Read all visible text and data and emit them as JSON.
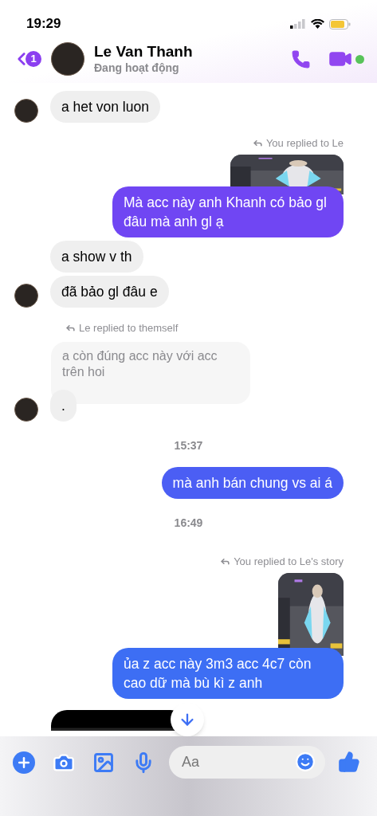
{
  "status_bar": {
    "time": "19:29"
  },
  "header": {
    "back_badge": "1",
    "name": "Le Van Thanh",
    "status": "Đang hoạt động",
    "online": true
  },
  "messages": [
    {
      "kind": "received",
      "text": "a het von luon",
      "avatar": true
    },
    {
      "kind": "reply_label_sent",
      "text": "You replied to Le"
    },
    {
      "kind": "reply_image"
    },
    {
      "kind": "sent",
      "text": "Mà acc này anh Khanh có bảo gl đâu mà anh gl ạ",
      "color": "#7046f3"
    },
    {
      "kind": "received",
      "text": "a show v th",
      "avatar": false
    },
    {
      "kind": "received",
      "text": "đã bảo gl đâu e",
      "avatar": true
    },
    {
      "kind": "reply_label_received",
      "text": "Le replied to themself"
    },
    {
      "kind": "quote",
      "text": "a còn đúng acc này với acc trên hoi"
    },
    {
      "kind": "received",
      "text": ".",
      "avatar": true
    },
    {
      "kind": "time",
      "text": "15:37"
    },
    {
      "kind": "sent",
      "text": "mà anh bán chung vs ai á",
      "color": "#4b5ef4"
    },
    {
      "kind": "time",
      "text": "16:49"
    },
    {
      "kind": "reply_label_sent",
      "text": "You replied to Le's story"
    },
    {
      "kind": "story_image"
    },
    {
      "kind": "sent",
      "text": "ủa z acc này 3m3 acc 4c7 còn cao dữ mà bù kì z anh",
      "color": "#3d6ef4"
    },
    {
      "kind": "received_image"
    }
  ],
  "composer": {
    "placeholder": "Aa"
  }
}
